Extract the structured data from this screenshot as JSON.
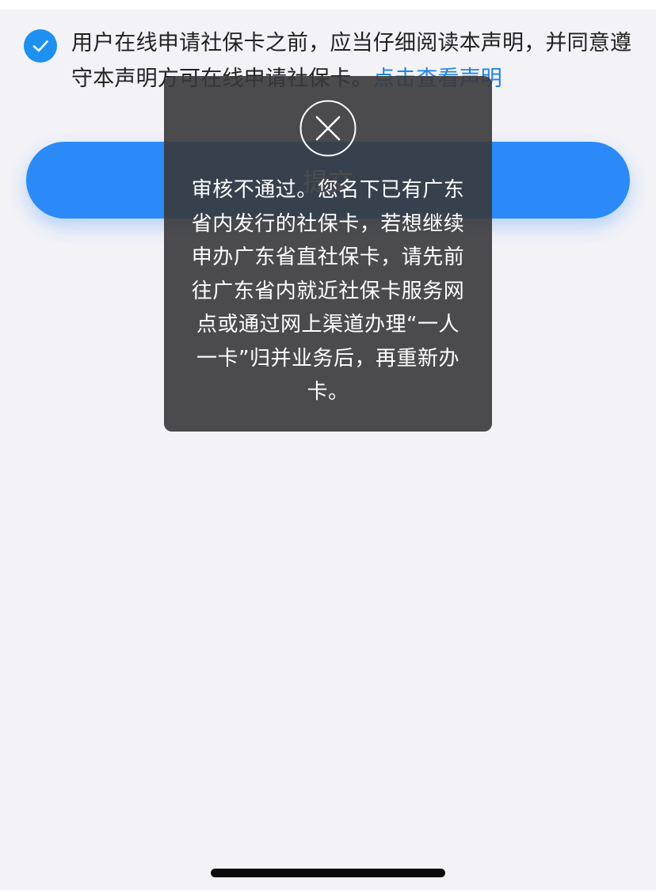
{
  "agreement": {
    "checked": true,
    "text": "用户在线申请社保卡之前，应当仔细阅读本声明，并同意遵守本声明方可在线申请社保卡。",
    "link": "点击查看声明"
  },
  "submit_button": {
    "label": "提交"
  },
  "toast": {
    "icon": "close-circle-icon",
    "message": "审核不通过。您名下已有广东省内发行的社保卡，若想继续申办广东省直社保卡，请先前往广东省内就近社保卡服务网点或通过网上渠道办理“一人一卡”归并业务后，再重新办卡。"
  },
  "colors": {
    "accent": "#2b8af7",
    "link": "#1f82e6",
    "toast_background": "#38383a",
    "page_background": "#f2f2f7"
  }
}
